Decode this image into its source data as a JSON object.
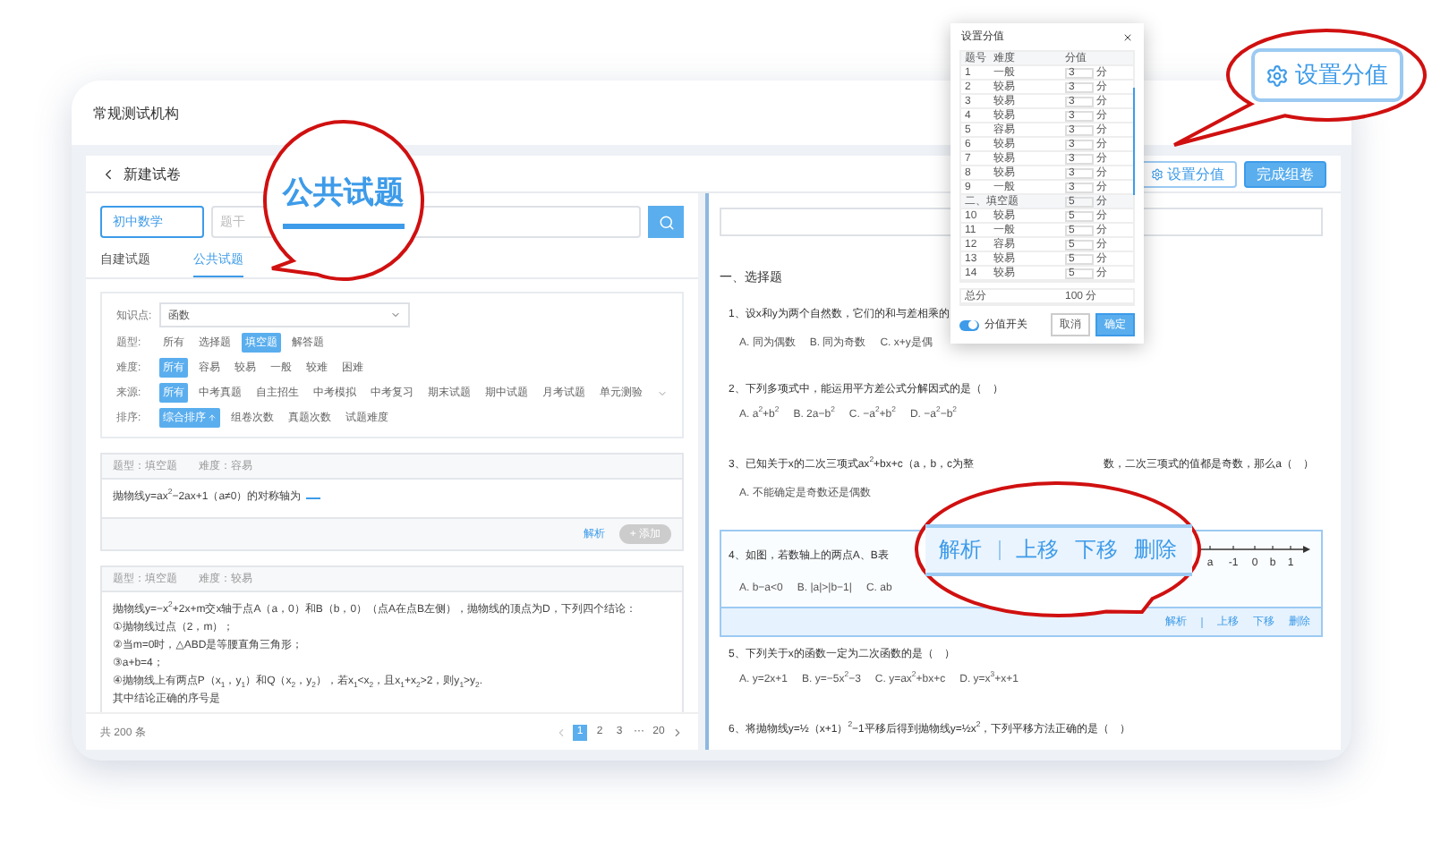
{
  "app": {
    "org": "常规测试机构"
  },
  "header": {
    "title": "新建试卷",
    "buttons": [
      {
        "label": "设置分值",
        "kind": "outline"
      },
      {
        "label": "完成组卷",
        "kind": "primary"
      }
    ]
  },
  "left": {
    "subject": "初中数学",
    "search_placeholder": "题干",
    "tabs": [
      {
        "label": "自建试题",
        "selected": false
      },
      {
        "label": "公共试题",
        "selected": true
      }
    ],
    "knowledge": {
      "label": "知识点:",
      "value": "函数"
    },
    "filters": [
      {
        "label": "题型:",
        "options": [
          {
            "label": "所有",
            "selected": false
          },
          {
            "label": "选择题",
            "selected": false
          },
          {
            "label": "填空题",
            "selected": true
          },
          {
            "label": "解答题",
            "selected": false
          }
        ]
      },
      {
        "label": "难度:",
        "options": [
          {
            "label": "所有",
            "selected": true
          },
          {
            "label": "容易",
            "selected": false
          },
          {
            "label": "较易",
            "selected": false
          },
          {
            "label": "一般",
            "selected": false
          },
          {
            "label": "较难",
            "selected": false
          },
          {
            "label": "困难",
            "selected": false
          }
        ]
      },
      {
        "label": "来源:",
        "expandable": true,
        "options": [
          {
            "label": "所有",
            "selected": true
          },
          {
            "label": "中考真题",
            "selected": false
          },
          {
            "label": "自主招生",
            "selected": false
          },
          {
            "label": "中考模拟",
            "selected": false
          },
          {
            "label": "中考复习",
            "selected": false
          },
          {
            "label": "期末试题",
            "selected": false
          },
          {
            "label": "期中试题",
            "selected": false
          },
          {
            "label": "月考试题",
            "selected": false
          },
          {
            "label": "单元测验",
            "selected": false
          }
        ]
      },
      {
        "label": "排序:",
        "options": [
          {
            "label": "综合排序",
            "selected": true,
            "sort_ascending": true
          },
          {
            "label": "组卷次数",
            "selected": false
          },
          {
            "label": "真题次数",
            "selected": false
          },
          {
            "label": "试题难度",
            "selected": false
          }
        ]
      }
    ],
    "questions": [
      {
        "meta": [
          "题型：填空题",
          "难度：容易"
        ],
        "lines": [
          "抛物线y=ax$^{2}$−2ax+1（a≠0）的对称轴为"
        ],
        "blank": true,
        "actions": {
          "analysis": "解析",
          "add": {
            "label": "+ 添加",
            "disabled": true
          }
        }
      },
      {
        "meta": [
          "题型：填空题",
          "难度：较易"
        ],
        "lines": [
          "抛物线y=−x$^{2}$+2x+m交x轴于点A（a，0）和B（b，0）（点A在点B左侧），抛物线的顶点为D，下列四个结论：",
          "①抛物线过点（2，m）；",
          "②当m=0时，△ABD是等腰直角三角形；",
          "③a+b=4；",
          "④抛物线上有两点P（x$_{1}$，y$_{1}$）和Q（x$_{2}$，y$_{2}$），若x$_{1}$<x$_{2}$，且x$_{1}$+x$_{2}$>2，则y$_{1}$>y$_{2}$.",
          "其中结论正确的序号是"
        ]
      }
    ],
    "pagination": {
      "total": "共 200 条",
      "pages": [
        {
          "label": "1",
          "selected": true
        },
        {
          "label": "2",
          "selected": false
        },
        {
          "label": "3",
          "selected": false
        },
        {
          "label": "···",
          "selected": false
        },
        {
          "label": "20",
          "selected": false
        }
      ]
    }
  },
  "right": {
    "section": "一、选择题",
    "questions": [
      {
        "stem": "1、设x和y为两个自然数，它们的和与差相乘的",
        "options": [
          "A. 同为偶数",
          "B. 同为奇数",
          "C. x+y是偶"
        ],
        "selected": false
      },
      {
        "stem": "2、下列多项式中，能运用平方差公式分解因式的是（　）",
        "options": [
          "A. a$^{2}$+b$^{2}$",
          "B. 2a−b$^{2}$",
          "C. −a$^{2}$+b$^{2}$",
          "D. −a$^{2}$−b$^{2}$"
        ],
        "selected": false
      },
      {
        "stem": "3、已知关于x的二次三项式ax$^{2}$+bx+c（a，b，c为整",
        "stem_tail": "数，二次三项式的值都是奇数，那么a（　）",
        "options": [
          "A. 不能确定是奇数还是偶数"
        ],
        "selected": false
      },
      {
        "stem": "4、如图，若数轴上的两点A、B表",
        "options": [
          "A. b−a<0",
          "B. |a|>|b−1|",
          "C. ab"
        ],
        "figure": [
          "a",
          "-1",
          "0",
          "b",
          "1"
        ],
        "selected": true
      },
      {
        "stem": "5、下列关于x的函数一定为二次函数的是（　）",
        "options": [
          "A. y=2x+1",
          "B. y=−5x$^{2}$−3",
          "C. y=ax$^{2}$+bx+c",
          "D. y=x$^{3}$+x+1"
        ],
        "selected": false
      },
      {
        "stem": "6、将抛物线y=½（x+1）$^{2}$−1平移后得到抛物线y=½x$^{2}$，下列平移方法正确的是（　）",
        "selected": false
      }
    ],
    "question_actions": [
      "解析",
      "上移",
      "下移",
      "删除"
    ]
  },
  "dialog": {
    "title": "设置分值",
    "columns": [
      "题号",
      "难度",
      "分值"
    ],
    "rows": [
      {
        "kind": "item",
        "no": "1",
        "level": "一般",
        "score": "3",
        "unit": "分"
      },
      {
        "kind": "item",
        "no": "2",
        "level": "较易",
        "score": "3",
        "unit": "分"
      },
      {
        "kind": "item",
        "no": "3",
        "level": "较易",
        "score": "3",
        "unit": "分"
      },
      {
        "kind": "item",
        "no": "4",
        "level": "较易",
        "score": "3",
        "unit": "分"
      },
      {
        "kind": "item",
        "no": "5",
        "level": "容易",
        "score": "3",
        "unit": "分"
      },
      {
        "kind": "item",
        "no": "6",
        "level": "较易",
        "score": "3",
        "unit": "分"
      },
      {
        "kind": "item",
        "no": "7",
        "level": "较易",
        "score": "3",
        "unit": "分"
      },
      {
        "kind": "item",
        "no": "8",
        "level": "较易",
        "score": "3",
        "unit": "分"
      },
      {
        "kind": "item",
        "no": "9",
        "level": "一般",
        "score": "3",
        "unit": "分"
      },
      {
        "kind": "section",
        "label": "二、填空题",
        "score": "5",
        "unit": "分"
      },
      {
        "kind": "item",
        "no": "10",
        "level": "较易",
        "score": "5",
        "unit": "分"
      },
      {
        "kind": "item",
        "no": "11",
        "level": "一般",
        "score": "5",
        "unit": "分"
      },
      {
        "kind": "item",
        "no": "12",
        "level": "容易",
        "score": "5",
        "unit": "分"
      },
      {
        "kind": "item",
        "no": "13",
        "level": "较易",
        "score": "5",
        "unit": "分"
      },
      {
        "kind": "item",
        "no": "14",
        "level": "较易",
        "score": "5",
        "unit": "分"
      }
    ],
    "total": {
      "label": "总分",
      "value": "100",
      "unit": "分"
    },
    "toggle": {
      "label": "分值开关",
      "on": true
    },
    "buttons": [
      {
        "label": "取消",
        "kind": "outline"
      },
      {
        "label": "确定",
        "kind": "primary"
      }
    ]
  },
  "callouts": [
    {
      "kind": "tab",
      "text": "公共试题"
    },
    {
      "kind": "button",
      "text": "设置分值"
    },
    {
      "kind": "actions",
      "items": [
        "解析",
        "上移",
        "下移",
        "删除"
      ]
    }
  ]
}
